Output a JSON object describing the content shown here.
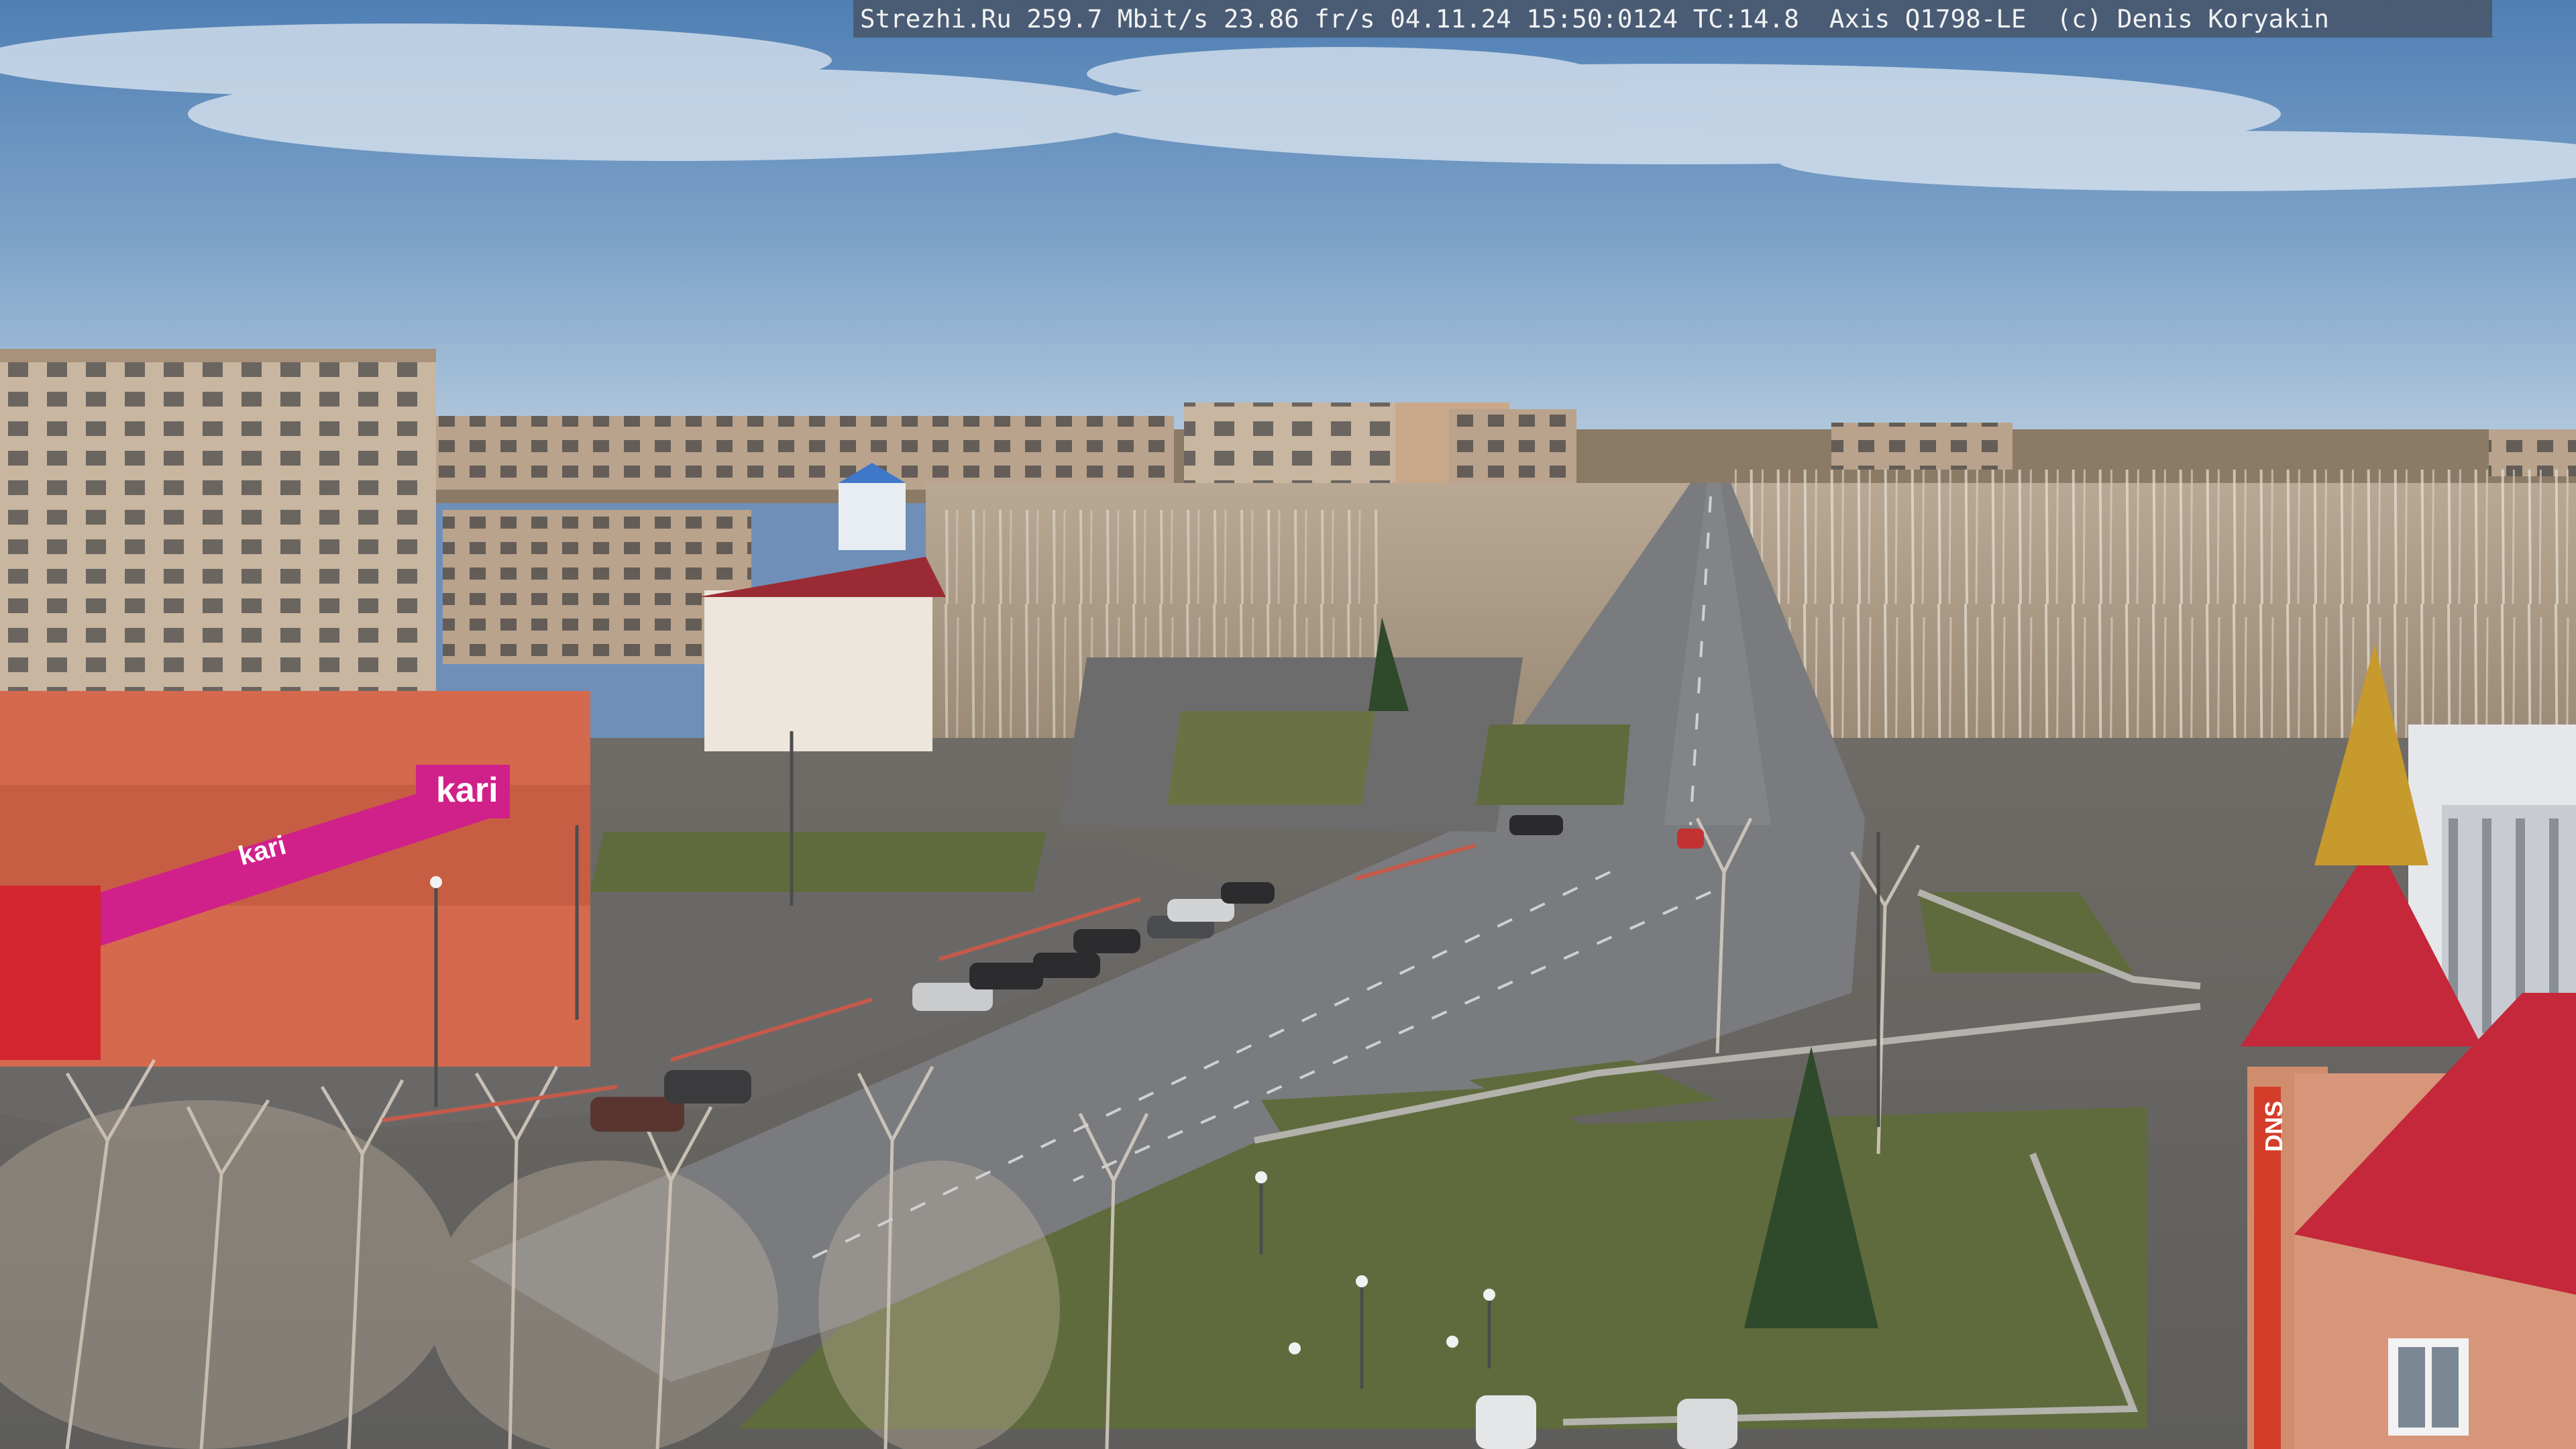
{
  "camera_overlay": {
    "text": "Strezhi.Ru 259.7 Mbit/s 23.86 fr/s 04.11.24 15:50:0124 TC:14.8  Axis Q1798-LE  (c) Denis Koryakin"
  },
  "signage": {
    "store_logo": "kari",
    "store_banner_logo": "kari",
    "right_building_sign": "DNS"
  },
  "colors": {
    "sky_top": "#4f7fb4",
    "sky_horizon": "#a9c3dc",
    "road": "#76777a",
    "grass": "#5b6a3a",
    "kari_pink": "#d0208a",
    "roof_red": "#c4283a"
  }
}
